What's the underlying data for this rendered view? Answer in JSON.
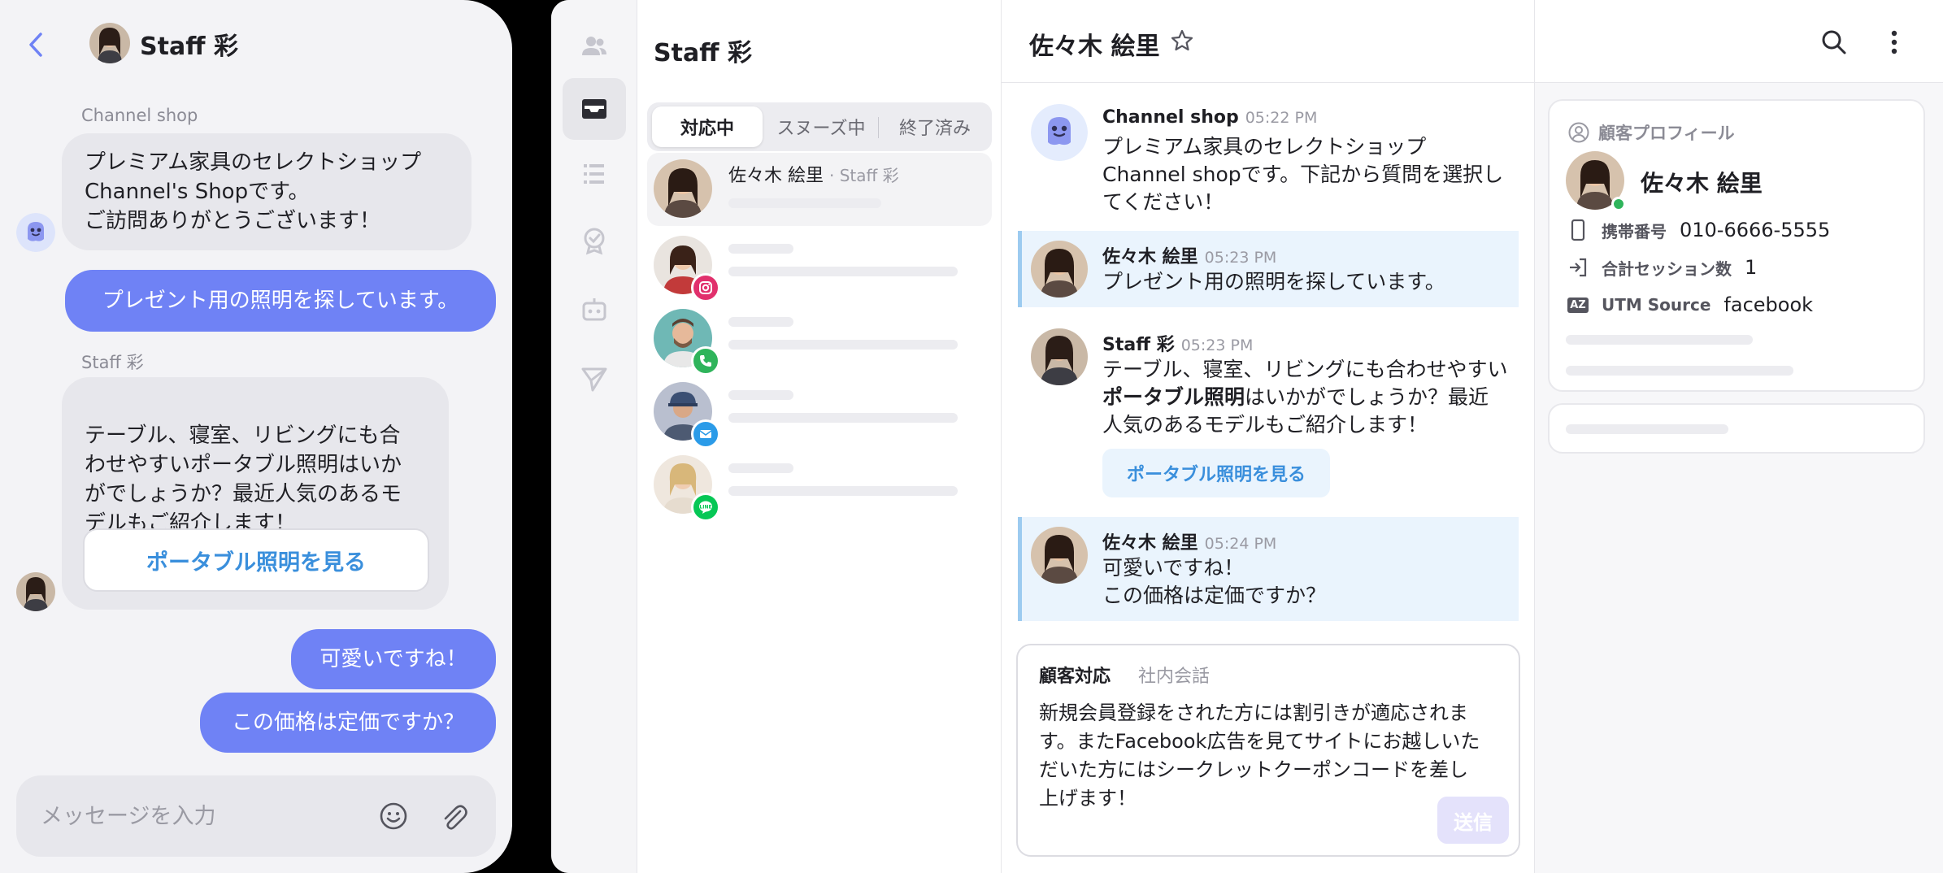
{
  "phone": {
    "header_name": "Staff 彩",
    "bot_sender": "Channel shop",
    "bot_message": "プレミアム家具のセレクトショップ\nChannel's Shopです。\nご訪問ありがとうございます！",
    "user_message_1": "プレゼント用の照明を探しています。",
    "staff_sender": "Staff 彩",
    "staff_message": "テーブル、寝室、リビングにも合\nわせやすいポータブル照明はいか\nがでしょうか？最近人気のあるモ\nデルもご紹介します！",
    "cta_label": "ポータブル照明を見る",
    "user_message_2": "可愛いですね！",
    "user_message_3": "この価格は定価ですか？",
    "input_placeholder": "メッセージを入力"
  },
  "inbox": {
    "title": "Staff 彩",
    "tabs": [
      "対応中",
      "スヌーズ中",
      "終了済み"
    ],
    "active_conversation": {
      "name": "佐々木 絵里",
      "assignee": "· Staff 彩"
    },
    "channel_badges": [
      "instagram-icon",
      "phone-icon",
      "mail-icon",
      "line-icon"
    ]
  },
  "chat": {
    "title": "佐々木 絵里",
    "messages": [
      {
        "name": "Channel shop",
        "time": "05:22 PM",
        "text": "プレミアム家具のセレクトショップ\nChannel shopです。下記から質問を選択し\nてください！"
      },
      {
        "name": "佐々木 絵里",
        "time": "05:23 PM",
        "text": "プレゼント用の照明を探しています。"
      },
      {
        "name": "Staff 彩",
        "time": "05:23 PM",
        "text_before": "テーブル、寝室、リビングにも合わせやすい\n",
        "text_bold": "ポータブル照明",
        "text_after": "はいかがでしょうか？最近\n人気のあるモデルもご紹介します！"
      },
      {
        "name": "佐々木 絵里",
        "time": "05:24 PM",
        "text": "可愛いですね！\nこの価格は定価ですか？"
      }
    ],
    "cta_label": "ポータブル照明を見る",
    "composer": {
      "tab_customer": "顧客対応",
      "tab_internal": "社内会話",
      "draft": "新規会員登録をされた方には割引きが適応されま\nす。またFacebook広告を見てサイトにお越しいた\nだいた方にはシークレットクーポンコードを差し\n上げます！",
      "send_label": "送信"
    }
  },
  "profile": {
    "section_title": "顧客プロフィール",
    "name": "佐々木 絵里",
    "rows": [
      {
        "label": "携帯番号",
        "value": "010-6666-5555"
      },
      {
        "label": "合計セッション数",
        "value": "1"
      },
      {
        "label": "UTM Source",
        "value": "facebook"
      }
    ],
    "utm_icon_text": "AZ"
  },
  "colors": {
    "user_bubble": "#6f82f5",
    "accent_blue": "#3a8fdc",
    "highlight_bg": "#eaf4fd",
    "online": "#2fb45b",
    "instagram": "#e1306c",
    "phone": "#2fb45b",
    "mail": "#2b9be8",
    "line": "#06c755"
  }
}
